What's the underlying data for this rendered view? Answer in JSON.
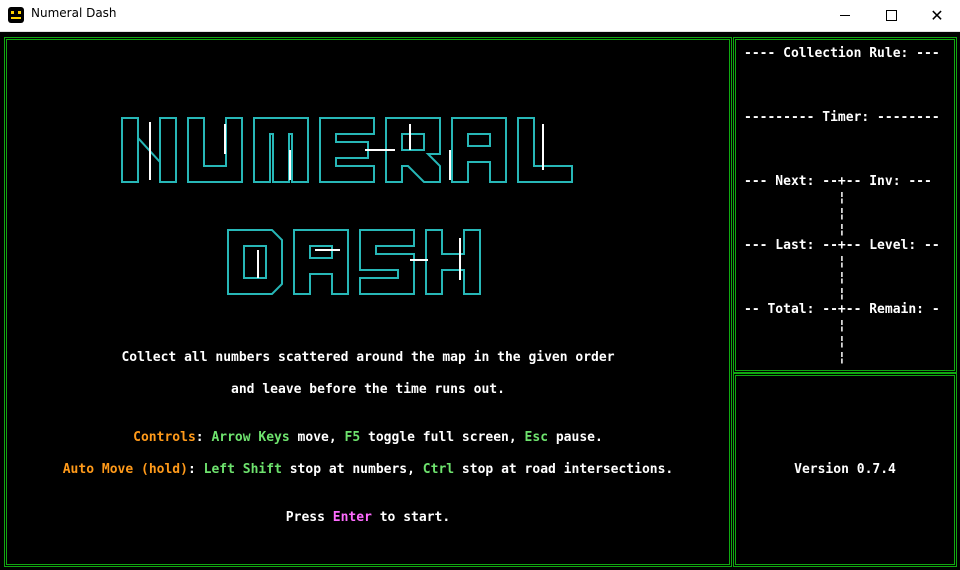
{
  "window": {
    "title": "Numeral Dash"
  },
  "logo": {
    "line1": "NUMERAL",
    "line2": "DASH"
  },
  "intro": {
    "line1": "Collect all numbers scattered around the map in the given order",
    "line2": "and leave before the time runs out."
  },
  "controls": {
    "label": "Controls",
    "arrow_keys": "Arrow Keys",
    "move": " move, ",
    "f5": "F5",
    "toggle": " toggle full screen, ",
    "esc": "Esc",
    "pause": " pause."
  },
  "automove": {
    "label": "Auto Move (hold)",
    "left_shift": "Left Shift",
    "stop_numbers": " stop at numbers, ",
    "ctrl": "Ctrl",
    "stop_roads": " stop at road intersections."
  },
  "start": {
    "press": "Press ",
    "enter": "Enter",
    "to_start": " to start."
  },
  "sidebar": {
    "collection_rule": "---- Collection Rule: ---",
    "timer": "--------- Timer: --------",
    "next_row": "--- Next: --+-- Inv: ---",
    "last_row": "--- Last: --+-- Level: --",
    "total_row": "-- Total: --+-- Remain: -",
    "divider_glyph": "¦",
    "version": "Version 0.7.4"
  },
  "colors": {
    "border": "#11a811",
    "logo": "#27b7b7",
    "orange": "#ff9a1a",
    "green": "#6ee36e",
    "pink": "#ff6bff"
  }
}
